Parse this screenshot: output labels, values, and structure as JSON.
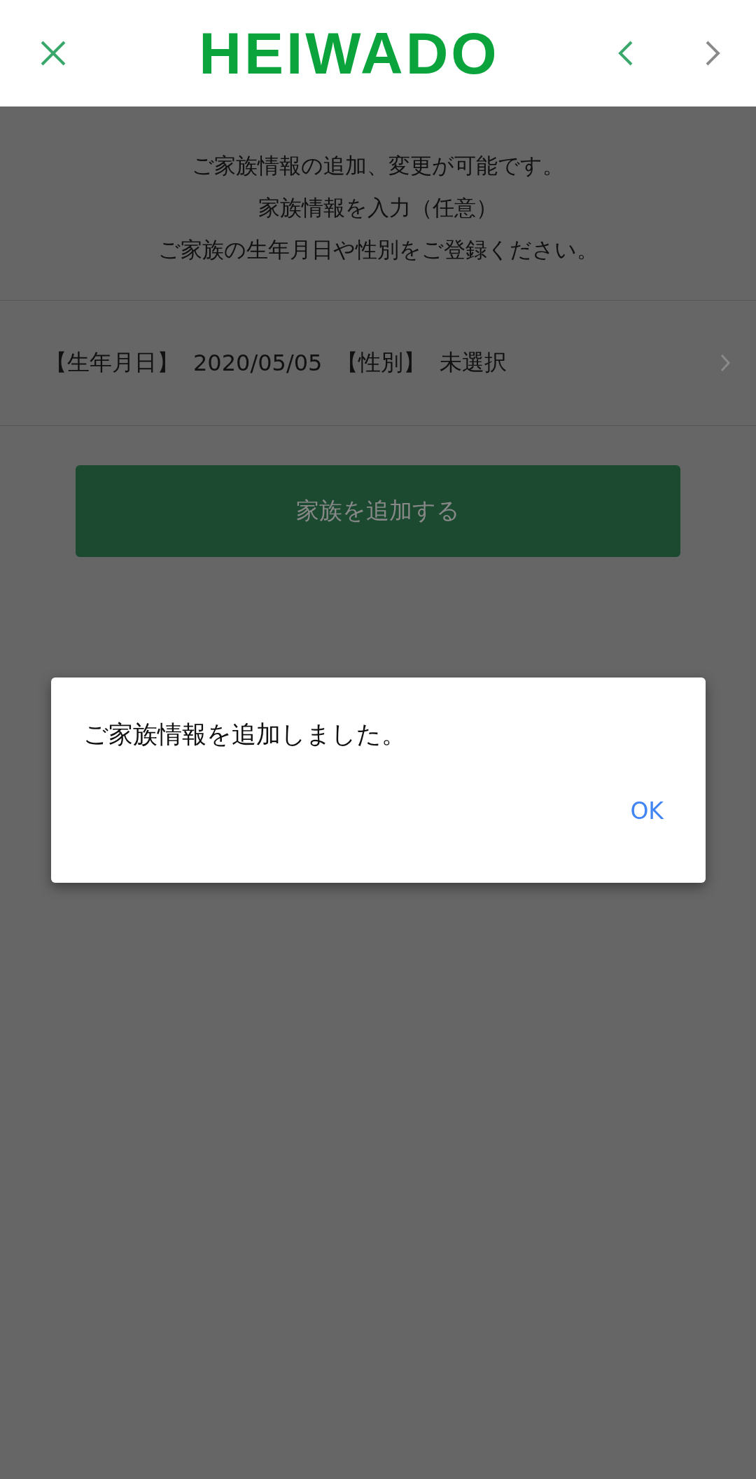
{
  "header": {
    "logo": "HEIWADO",
    "back_enabled": true,
    "forward_enabled": false
  },
  "intro": [
    "ご家族情報の追加、変更が可能です。",
    "家族情報を入力（任意）",
    "ご家族の生年月日や性別をご登録ください。"
  ],
  "family_members": [
    {
      "birthday_label": "【生年月日】",
      "birthday": "2020/05/05",
      "gender_label": "【性別】",
      "gender": "未選択"
    }
  ],
  "add_button": {
    "label": "家族を追加する"
  },
  "dialog": {
    "message": "ご家族情報を追加しました。",
    "ok": "OK"
  }
}
